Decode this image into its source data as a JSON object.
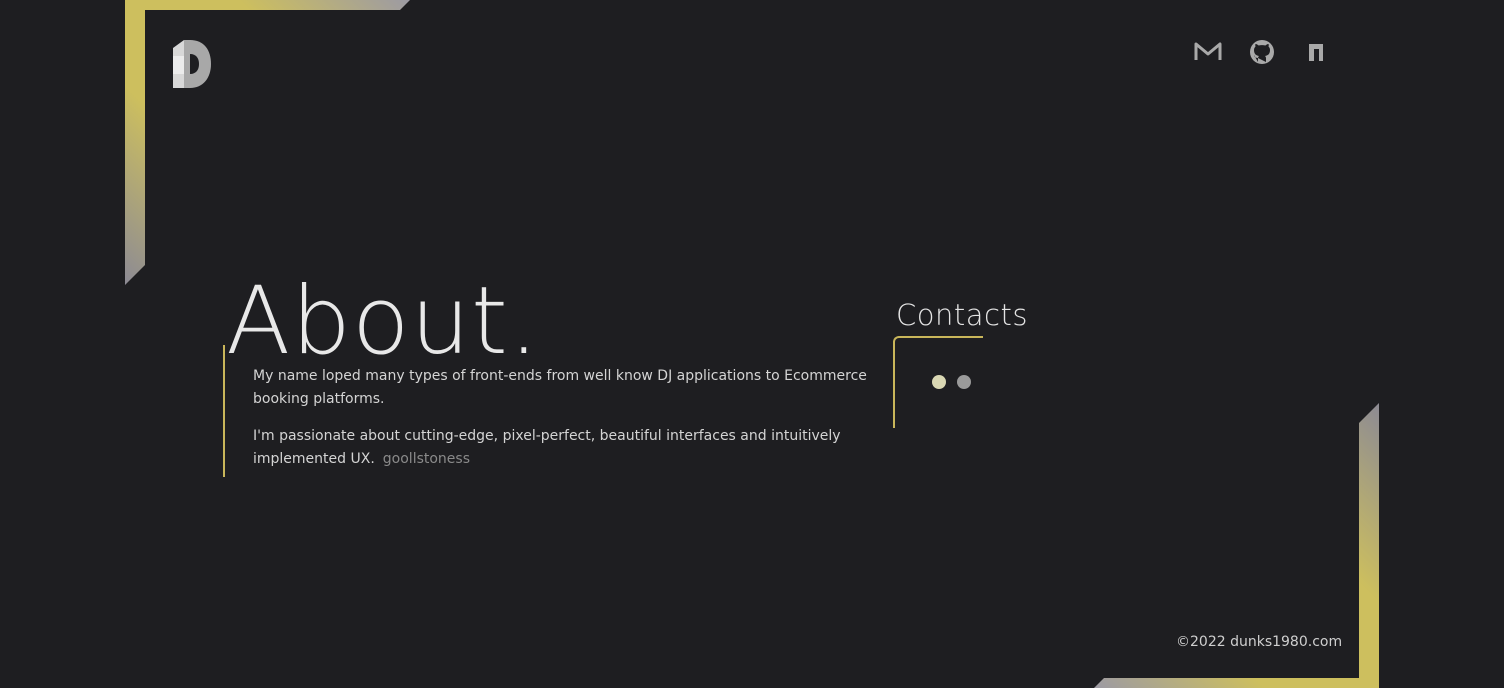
{
  "header": {
    "logo_icon": "pd-monogram-icon",
    "social_links": [
      {
        "name": "gmail",
        "icon": "mail-icon"
      },
      {
        "name": "github",
        "icon": "github-icon"
      },
      {
        "name": "other",
        "icon": "bookmark-icon"
      }
    ]
  },
  "about": {
    "title": "About.",
    "paragraph_1": "My name loped many types of front-ends from well know DJ applications to Ecommerce booking platforms.",
    "paragraph_2_main": "I'm passionate about cutting-edge, pixel-perfect, beautiful interfaces and intuitively implemented UX.",
    "paragraph_2_faded": "goollstoness"
  },
  "contacts": {
    "title": "Contacts"
  },
  "footer": {
    "copyright": "©2022 dunks1980.com"
  },
  "colors": {
    "background": "#1e1e21",
    "accent_gold": "#c9b65a",
    "frame_gray": "#8c8a94",
    "text": "#e6e6e6"
  }
}
